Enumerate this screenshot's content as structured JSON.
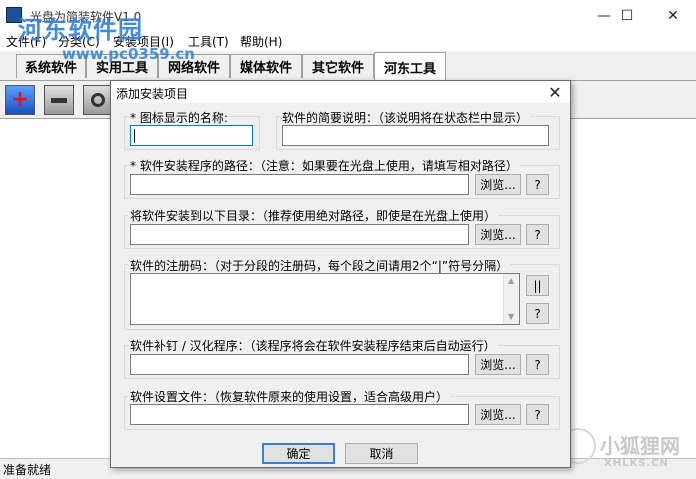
{
  "window": {
    "title": "光盘为简装软件V1.0",
    "minimize": "—",
    "maximize": "☐",
    "close": "✕"
  },
  "menu": [
    "文件(F)",
    "分类(C)",
    "安装项目(I)",
    "工具(T)",
    "帮助(H)"
  ],
  "tabs": [
    "系统软件",
    "实用工具",
    "网络软件",
    "媒体软件",
    "其它软件",
    "河东工具"
  ],
  "active_tab": "河东工具",
  "toolbar": {
    "tools": [
      "add-icon",
      "remove-icon",
      "settings-icon"
    ]
  },
  "status": "准备就绪",
  "watermark": {
    "logo": "河东软件园",
    "url": "www.pc0359.cn",
    "brand": "小狐狸网",
    "brand_sub": "XHLKS.CN"
  },
  "dialog": {
    "title": "添加安装项目",
    "close": "✕",
    "icon_name_label": "*  图标显示的名称:",
    "icon_name_value": "",
    "desc_label": "软件的简要说明：（该说明将在状态栏中显示）",
    "desc_value": "",
    "path_label": "*  软件安装程序的路径：（注意：如果要在光盘上使用，请填写相对路径）",
    "path_value": "",
    "target_label": "将软件安装到以下目录：（推荐使用绝对路径，即使是在光盘上使用）",
    "target_value": "",
    "serial_label": "软件的注册码：（对于分段的注册码，每个段之间请用2个“|”符号分隔）",
    "serial_value": "",
    "patch_label": "软件补钉 / 汉化程序：（该程序将会在软件安装程序结束后自动运行）",
    "patch_value": "",
    "config_label": "软件设置文件：（恢复软件原来的使用设置，适合高级用户）",
    "config_value": "",
    "browse": "浏览...",
    "help": "?",
    "separator": "||",
    "ok": "确定",
    "cancel": "取消"
  }
}
